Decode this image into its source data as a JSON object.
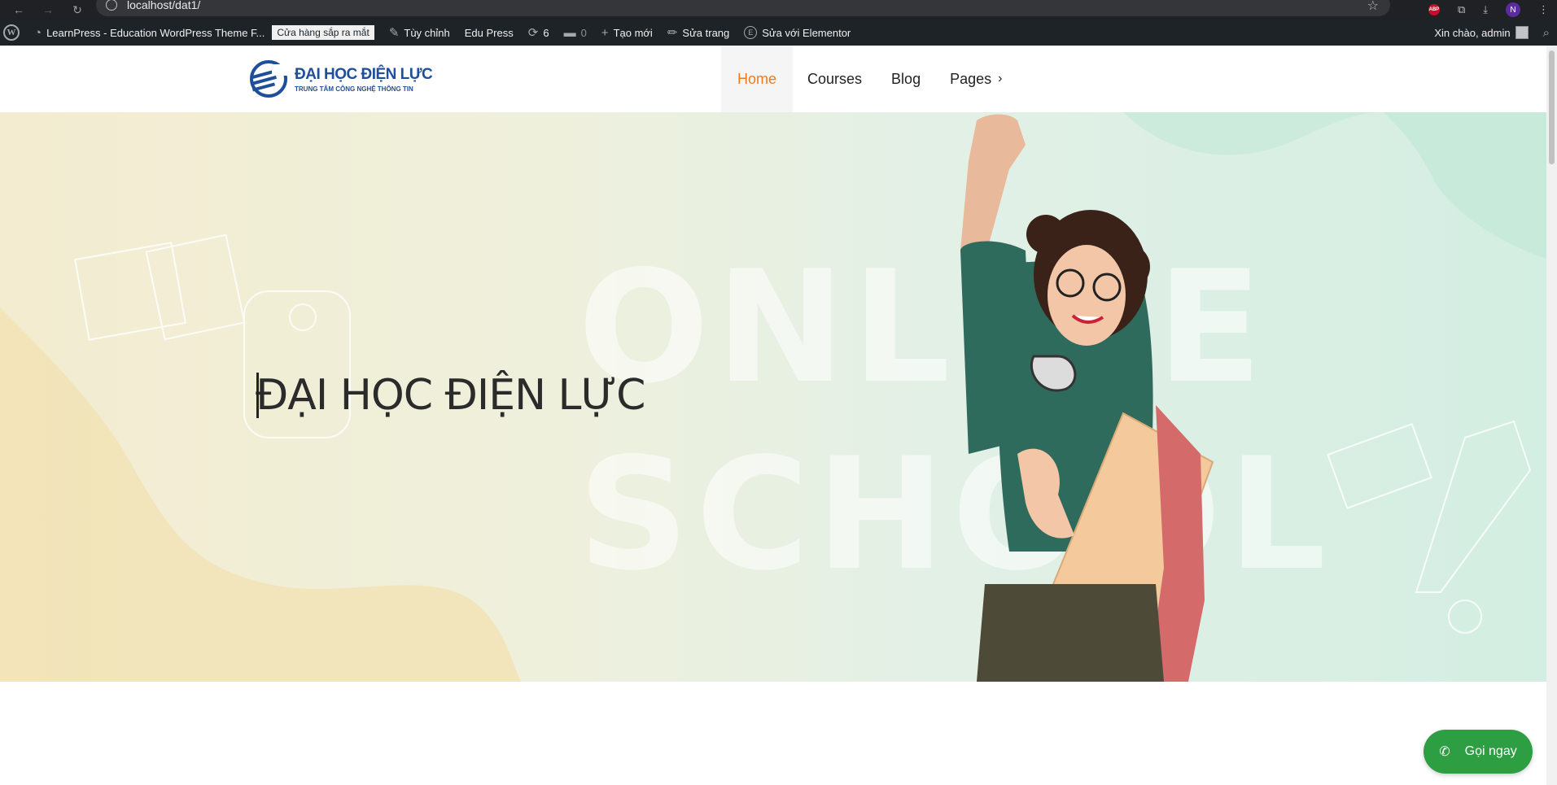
{
  "browser": {
    "url": "localhost/dat1/",
    "profile_initial": "N",
    "extension_label": "ABP"
  },
  "adminbar": {
    "wp_logo": "W",
    "site_name": "LearnPress - Education WordPress Theme F...",
    "coming_soon_badge": "Cửa hàng sắp ra mắt",
    "customize": "Tùy chỉnh",
    "theme": "Edu Press",
    "updates_count": "6",
    "comments_count": "0",
    "new": "Tạo mới",
    "edit_page": "Sửa trang",
    "elementor": "Sửa với Elementor",
    "elementor_icon": "E",
    "greeting": "Xin chào, admin"
  },
  "header": {
    "logo_main": "ĐẠI HỌC ĐIỆN LỰC",
    "logo_sub": "TRUNG TÂM CÔNG NGHỆ THÔNG TIN",
    "nav": [
      {
        "label": "Home"
      },
      {
        "label": "Courses"
      },
      {
        "label": "Blog"
      },
      {
        "label": "Pages"
      }
    ]
  },
  "hero": {
    "title": "ĐẠI HỌC ĐIỆN LỰC",
    "background_text_1": "ONLINE",
    "background_text_2": "SCHOOL"
  },
  "call_button": {
    "label": "Gọi ngay"
  },
  "colors": {
    "accent": "#f07b1e",
    "call": "#2e9e43",
    "adminbar": "#1d2327",
    "logo_blue": "#1f4f9a"
  }
}
